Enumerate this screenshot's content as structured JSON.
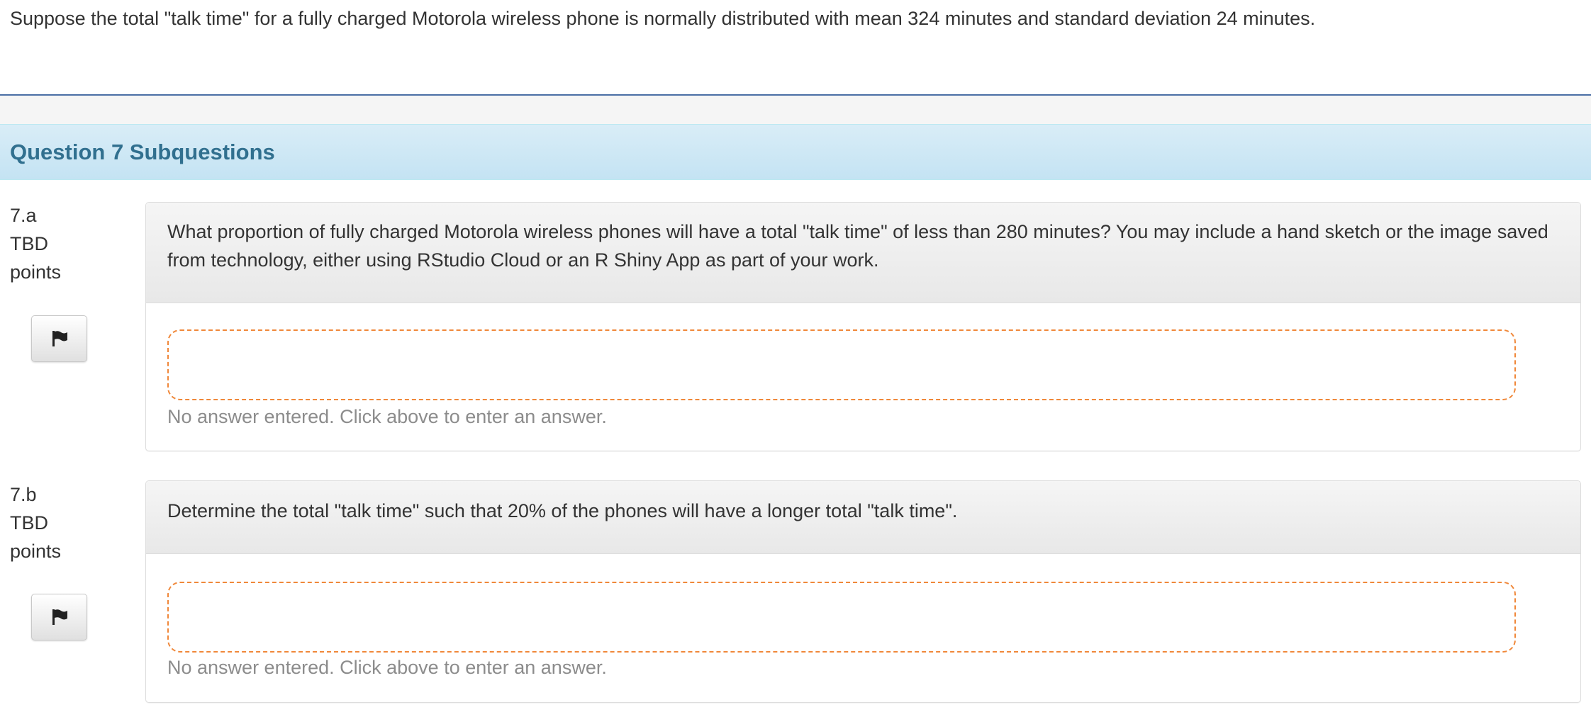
{
  "intro_text": "Suppose the total \"talk time\" for a fully charged Motorola wireless phone is normally distributed with mean 324 minutes and standard deviation 24 minutes.",
  "subquestions_title": "Question 7 Subquestions",
  "questions": [
    {
      "number": "7.a",
      "points_value": "TBD",
      "points_label": "points",
      "flag_icon": "flag-icon",
      "prompt": "What proportion of fully charged Motorola wireless phones will have a total \"talk time\" of less than 280 minutes?  You may include a hand sketch or the image saved from technology, either using RStudio Cloud or an R Shiny App as part of your work.",
      "answer_value": "",
      "no_answer_text": "No answer entered. Click above to enter an answer."
    },
    {
      "number": "7.b",
      "points_value": "TBD",
      "points_label": "points",
      "flag_icon": "flag-icon",
      "prompt": "Determine the total \"talk time\" such that 20% of the phones will have a longer total \"talk time\".",
      "answer_value": "",
      "no_answer_text": "No answer entered. Click above to enter an answer."
    }
  ],
  "colors": {
    "header_text": "#31708f",
    "header_bg": "#d9edf7",
    "top_rule": "#4a6fa5",
    "answer_border": "#f0883a",
    "muted_text": "#8c8c8c"
  }
}
